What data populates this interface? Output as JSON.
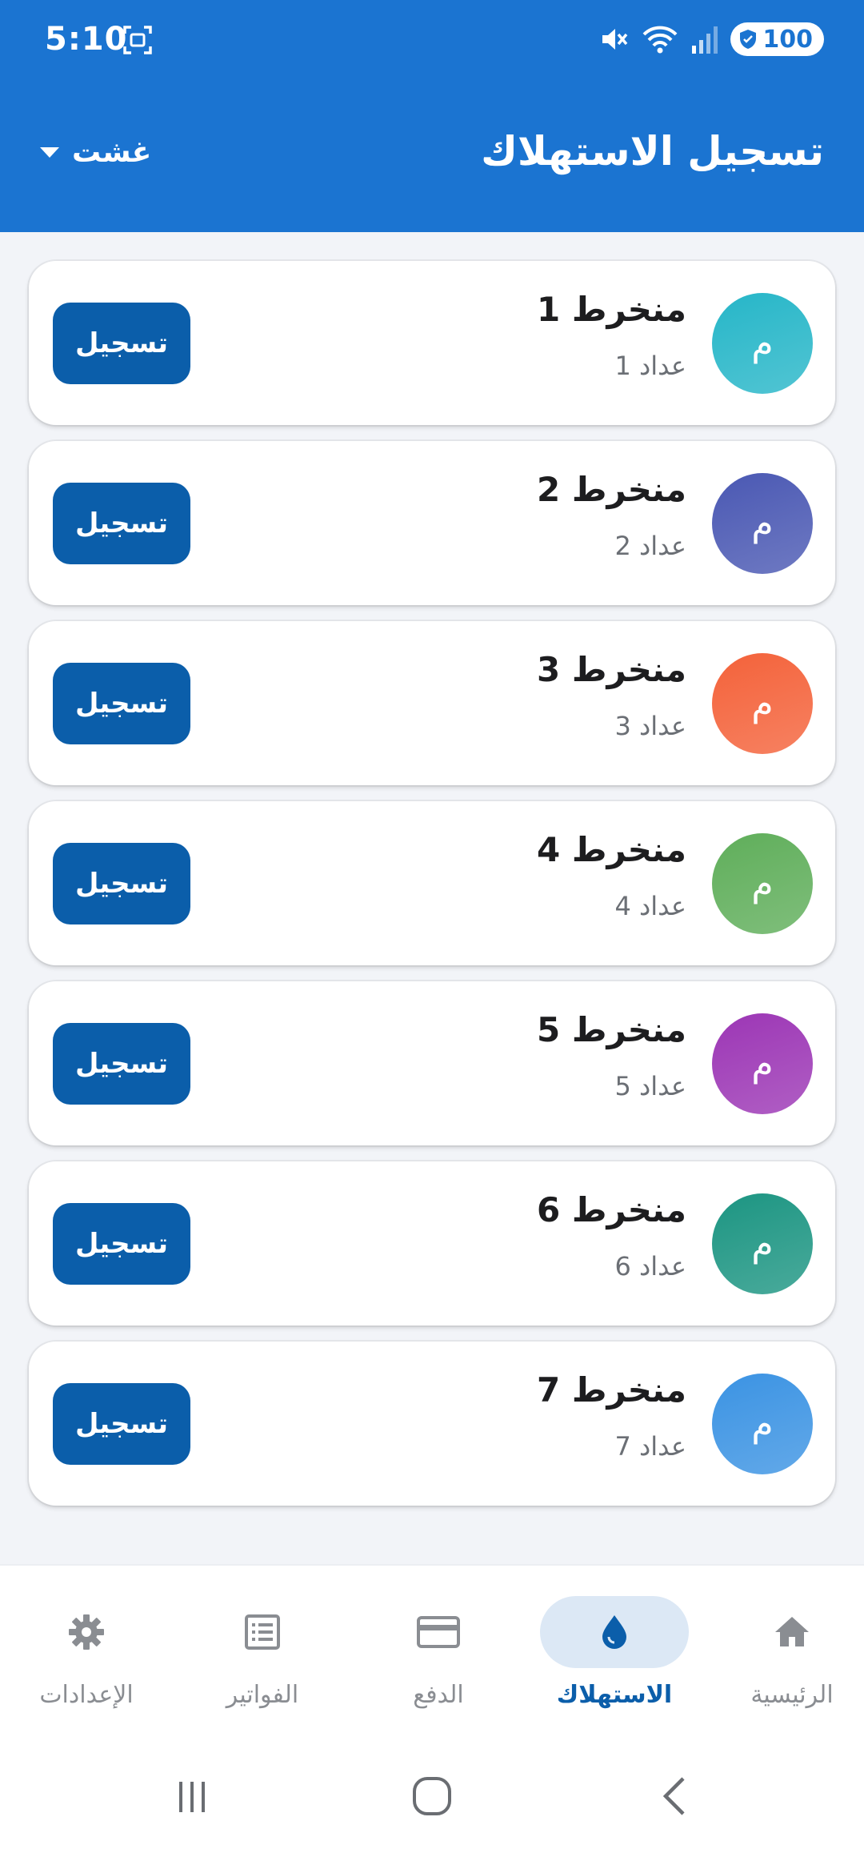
{
  "status_bar": {
    "time": "5:10",
    "battery": "100",
    "icons": [
      "screenshot-icon",
      "mute-icon",
      "wifi-icon",
      "signal-icon",
      "battery-shield-icon"
    ]
  },
  "app_bar": {
    "title": "تسجيل الاستهلاك",
    "user_select": "غشت"
  },
  "colors": {
    "primary": "#1b74d1",
    "button": "#0b5eaa",
    "avatar_colors": [
      "#26b6c8",
      "#4a58b3",
      "#f4623a",
      "#5fae5a",
      "#9c36b5",
      "#1c9582",
      "#3b93e3"
    ]
  },
  "subscribers": [
    {
      "avatar": "م",
      "name": "منخرط 1",
      "meter": "عداد 1",
      "action": "تسجيل"
    },
    {
      "avatar": "م",
      "name": "منخرط 2",
      "meter": "عداد 2",
      "action": "تسجيل"
    },
    {
      "avatar": "م",
      "name": "منخرط 3",
      "meter": "عداد 3",
      "action": "تسجيل"
    },
    {
      "avatar": "م",
      "name": "منخرط 4",
      "meter": "عداد 4",
      "action": "تسجيل"
    },
    {
      "avatar": "م",
      "name": "منخرط 5",
      "meter": "عداد 5",
      "action": "تسجيل"
    },
    {
      "avatar": "م",
      "name": "منخرط 6",
      "meter": "عداد 6",
      "action": "تسجيل"
    },
    {
      "avatar": "م",
      "name": "منخرط 7",
      "meter": "عداد 7",
      "action": "تسجيل"
    }
  ],
  "bottom_nav": [
    {
      "label": "الرئيسية",
      "icon": "home-icon",
      "active": false
    },
    {
      "label": "الاستهلاك",
      "icon": "water-drop-icon",
      "active": true
    },
    {
      "label": "الدفع",
      "icon": "credit-card-icon",
      "active": false
    },
    {
      "label": "الفواتير",
      "icon": "invoice-icon",
      "active": false
    },
    {
      "label": "الإعدادات",
      "icon": "settings-gear-icon",
      "active": false
    }
  ],
  "system_nav": [
    "recent-apps-icon",
    "home-circle-icon",
    "back-icon"
  ]
}
